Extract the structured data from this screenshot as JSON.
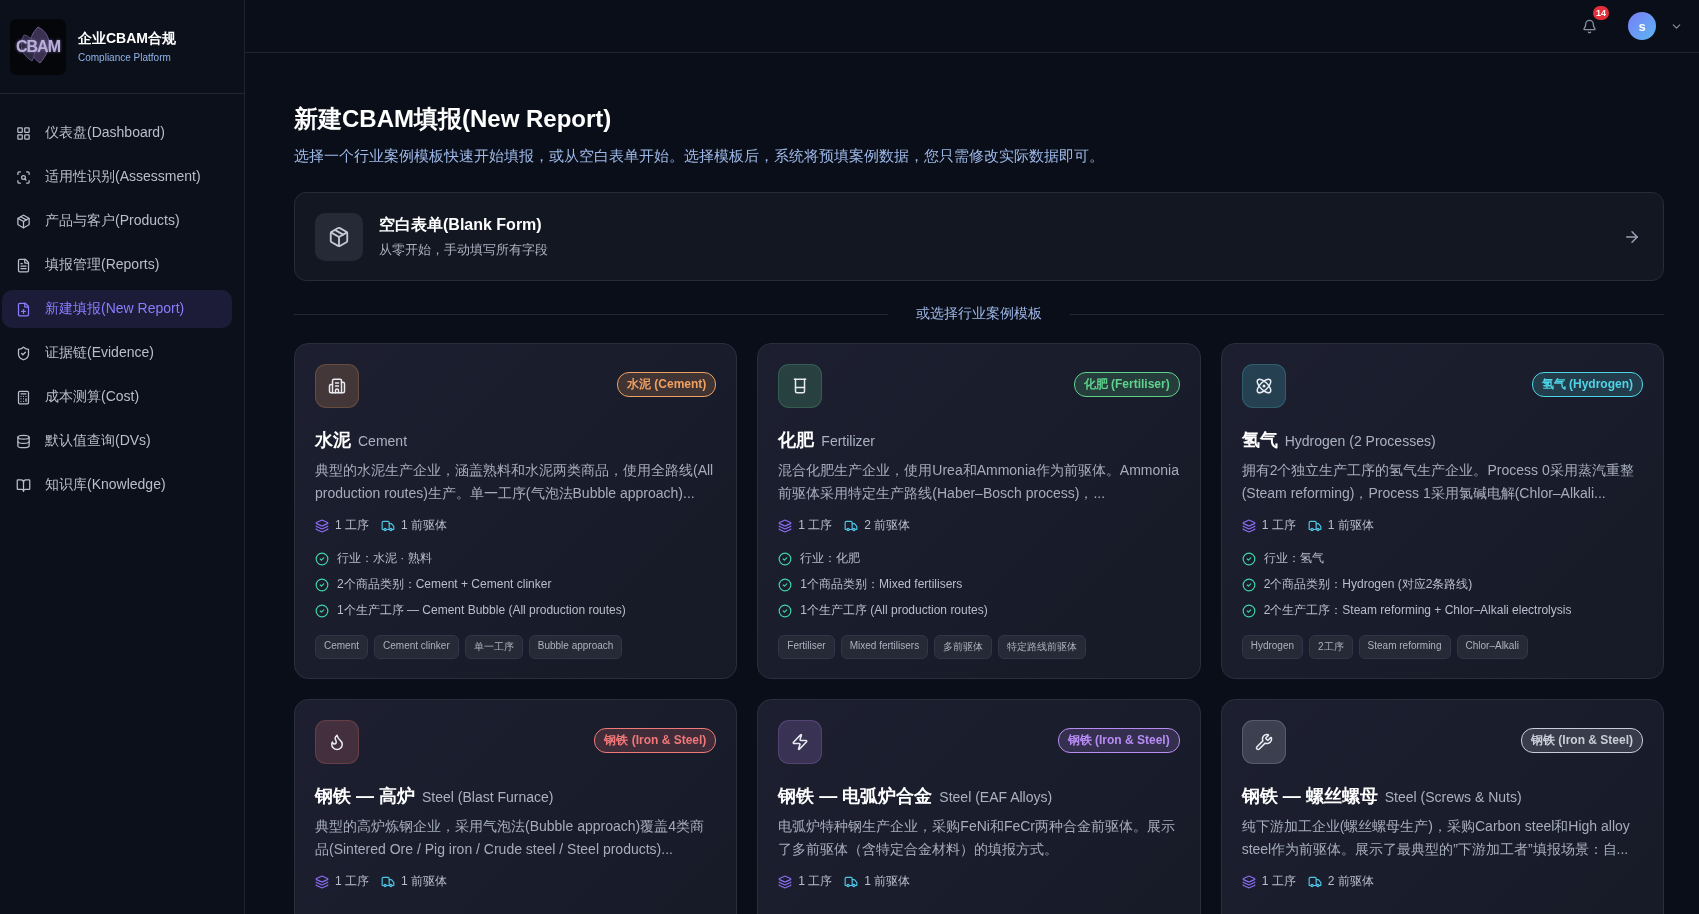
{
  "sidebar": {
    "logo_text": "CBAM",
    "brand": "企业CBAM合规",
    "subtitle": "Compliance Platform",
    "items": [
      {
        "label": "仪表盘(Dashboard)",
        "kind": "dashboard",
        "selected": false
      },
      {
        "label": "适用性识别(Assessment)",
        "kind": "scan",
        "selected": false
      },
      {
        "label": "产品与客户(Products)",
        "kind": "package",
        "selected": false
      },
      {
        "label": "填报管理(Reports)",
        "kind": "file",
        "selected": false
      },
      {
        "label": "新建填报(New Report)",
        "kind": "file-plus",
        "selected": true
      },
      {
        "label": "证据链(Evidence)",
        "kind": "shield",
        "selected": false
      },
      {
        "label": "成本测算(Cost)",
        "kind": "calculator",
        "selected": false
      },
      {
        "label": "默认值查询(DVs)",
        "kind": "database",
        "selected": false
      },
      {
        "label": "知识库(Knowledge)",
        "kind": "book",
        "selected": false
      }
    ]
  },
  "header": {
    "notification_count": "14",
    "avatar": "s"
  },
  "page": {
    "title": "新建CBAM填报(New Report)",
    "subtitle": "选择一个行业案例模板快速开始填报，或从空白表单开始。选择模板后，系统将预填案例数据，您只需修改实际数据即可。"
  },
  "blank_form": {
    "title": "空白表单(Blank Form)",
    "description": "从零开始，手动填写所有字段"
  },
  "divider_label": "或选择行业案例模板",
  "templates": [
    {
      "kind": "cement",
      "color": "#f0a060",
      "badge": "水泥 (Cement)",
      "title": "水泥",
      "subtitle": "Cement",
      "description": "典型的水泥生产企业，涵盖熟料和水泥两类商品，使用全路线(All production routes)生产。单一工序(气泡法Bubble approach)...",
      "processes": "1 工序",
      "precursors": "1 前驱体",
      "features": [
        "行业：水泥 · 熟料",
        "2个商品类别：Cement + Cement clinker",
        "1个生产工序 — Cement Bubble (All production routes)"
      ],
      "tags": [
        "Cement",
        "Cement clinker",
        "单一工序",
        "Bubble approach"
      ]
    },
    {
      "kind": "fertilizer",
      "color": "#5fd38d",
      "badge": "化肥 (Fertiliser)",
      "title": "化肥",
      "subtitle": "Fertilizer",
      "description": "混合化肥生产企业，使用Urea和Ammonia作为前驱体。Ammonia前驱体采用特定生产路线(Haber–Bosch process)，...",
      "processes": "1 工序",
      "precursors": "2 前驱体",
      "features": [
        "行业：化肥",
        "1个商品类别：Mixed fertilisers",
        "1个生产工序 (All production routes)"
      ],
      "tags": [
        "Fertiliser",
        "Mixed fertilisers",
        "多前驱体",
        "特定路线前驱体"
      ]
    },
    {
      "kind": "hydrogen",
      "color": "#4fd4e6",
      "badge": "氢气 (Hydrogen)",
      "title": "氢气",
      "subtitle": "Hydrogen (2 Processes)",
      "description": "拥有2个独立生产工序的氢气生产企业。Process 0采用蒸汽重整(Steam reforming)，Process 1采用氯碱电解(Chlor–Alkali...",
      "processes": "1 工序",
      "precursors": "1 前驱体",
      "features": [
        "行业：氢气",
        "2个商品类别：Hydrogen (对应2条路线)",
        "2个生产工序：Steam reforming + Chlor–Alkali electrolysis"
      ],
      "tags": [
        "Hydrogen",
        "2工序",
        "Steam reforming",
        "Chlor–Alkali"
      ]
    },
    {
      "kind": "blast-furnace",
      "color": "#f07878",
      "badge": "钢铁 (Iron & Steel)",
      "title": "钢铁 — 高炉",
      "subtitle": "Steel (Blast Furnace)",
      "description": "典型的高炉炼钢企业，采用气泡法(Bubble approach)覆盖4类商品(Sintered Ore / Pig iron / Crude steel / Steel products)...",
      "processes": "1 工序",
      "precursors": "1 前驱体"
    },
    {
      "kind": "eaf",
      "color": "#b88cf5",
      "badge": "钢铁 (Iron & Steel)",
      "title": "钢铁 — 电弧炉合金",
      "subtitle": "Steel (EAF Alloys)",
      "description": "电弧炉特种钢生产企业，采购FeNi和FeCr两种合金前驱体。展示了多前驱体（含特定合金材料）的填报方式。",
      "processes": "1 工序",
      "precursors": "1 前驱体"
    },
    {
      "kind": "fasteners",
      "color": "#c8ced8",
      "badge": "钢铁 (Iron & Steel)",
      "title": "钢铁 — 螺丝螺母",
      "subtitle": "Steel (Screws & Nuts)",
      "description": "纯下游加工企业(螺丝螺母生产)，采购Carbon steel和High alloy steel作为前驱体。展示了最典型的”下游加工者”填报场景：自...",
      "processes": "1 工序",
      "precursors": "2 前驱体"
    }
  ]
}
